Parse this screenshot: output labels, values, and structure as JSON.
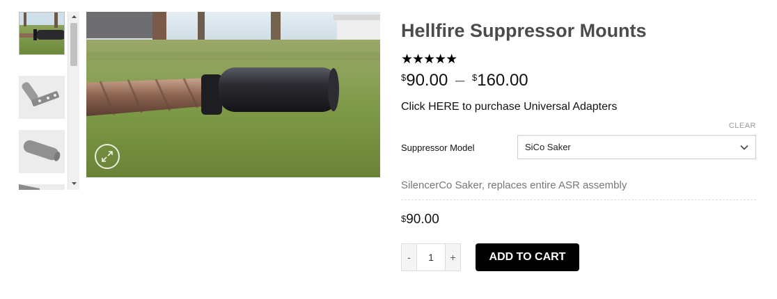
{
  "product": {
    "title": "Hellfire Suppressor Mounts",
    "rating_stars": "★★★★★",
    "price_min_symbol": "$",
    "price_min": "90.00",
    "price_separator": "–",
    "price_max_symbol": "$",
    "price_max": "160.00",
    "adapter_link": "Click HERE to purchase Universal Adapters",
    "clear_label": "CLEAR",
    "variation": {
      "label": "Suppressor Model",
      "selected": "SiCo Saker",
      "description": "SilencerCo Saker, replaces entire ASR assembly",
      "price_symbol": "$",
      "price": "90.00"
    },
    "quantity": {
      "minus": "-",
      "value": "1",
      "plus": "+"
    },
    "add_to_cart_label": "ADD TO CART"
  },
  "gallery": {
    "thumbnail_count": 4,
    "scroll_up_icon": "scroll-up-arrow-icon",
    "scroll_down_icon": "scroll-down-arrow-icon",
    "zoom_icon": "expand-icon"
  },
  "colors": {
    "title": "#4b4b4b",
    "button_bg": "#000000",
    "muted_text": "#777777"
  }
}
